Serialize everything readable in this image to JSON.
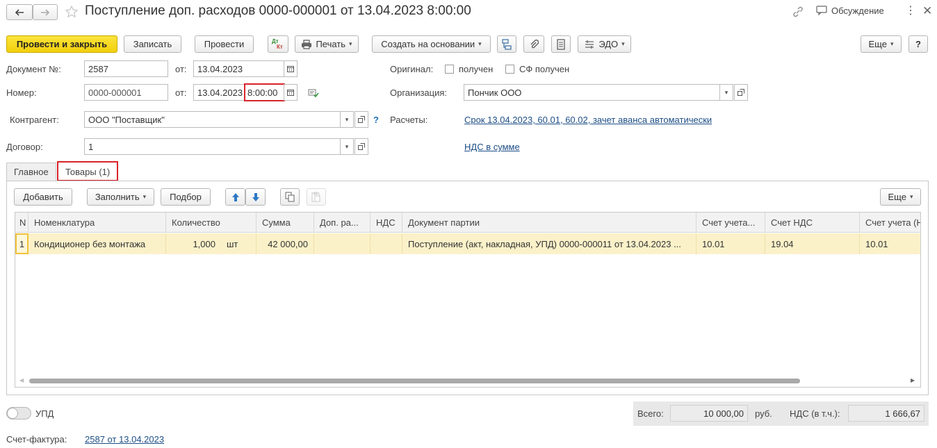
{
  "window": {
    "title": "Поступление доп. расходов 0000-000001 от 13.04.2023 8:00:00",
    "discussion": "Обсуждение"
  },
  "toolbar": {
    "post_close": "Провести и закрыть",
    "save": "Записать",
    "post": "Провести",
    "dtkt_top": "Дт",
    "dtkt_bottom": "Кт",
    "print": "Печать",
    "create_based": "Создать на основании",
    "edo": "ЭДО",
    "more": "Еще",
    "help": "?"
  },
  "form": {
    "doc_number_label": "Документ №:",
    "doc_number": "2587",
    "from_label": "от:",
    "doc_date": "13.04.2023",
    "number_label": "Номер:",
    "number": "0000-000001",
    "number_from_label": "от:",
    "date": "13.04.2023",
    "time": "8:00:00",
    "original_label": "Оригинал:",
    "received": "получен",
    "sf_received": "СФ получен",
    "org_label": "Организация:",
    "org": "Пончик ООО",
    "contractor_label": "Контрагент:",
    "contractor": "ООО \"Поставщик\"",
    "help_q": "?",
    "settlements_label": "Расчеты:",
    "settlements_link": "Срок 13.04.2023, 60.01, 60.02, зачет аванса автоматически",
    "contract_label": "Договор:",
    "contract": "1",
    "vat_link": "НДС в сумме"
  },
  "tabs": [
    {
      "label": "Главное"
    },
    {
      "label": "Товары (1)"
    }
  ],
  "goods_toolbar": {
    "add": "Добавить",
    "fill": "Заполнить",
    "pick": "Подбор",
    "more": "Еще"
  },
  "table": {
    "headers": [
      "N",
      "Номенклатура",
      "Количество",
      "Сумма",
      "Доп. ра...",
      "НДС",
      "Документ партии",
      "Счет учета...",
      "Счет НДС",
      "Счет учета (Н"
    ],
    "rows": [
      {
        "n": "1",
        "item": "Кондиционер без монтажа",
        "qty": "1,000",
        "unit": "шт",
        "sum": "42 000,00",
        "extra": "",
        "vat": "",
        "batch_doc": "Поступление (акт, накладная, УПД) 0000-000011 от 13.04.2023 ...",
        "account": "10.01",
        "vat_account": "19.04",
        "account_tax": "10.01"
      }
    ]
  },
  "footer": {
    "upd_label": "УПД",
    "upd_on": false,
    "total_label": "Всего:",
    "total": "10 000,00",
    "currency": "руб.",
    "vat_label": "НДС (в т.ч.):",
    "vat": "1 666,67",
    "invoice_label": "Счет-фактура:",
    "invoice_link": "2587 от 13.04.2023"
  },
  "colors": {
    "accent_yellow": "#f5d41a",
    "highlight_red": "#d8232a",
    "link_blue": "#1d4e86",
    "row_selected": "#fbf1c9"
  }
}
